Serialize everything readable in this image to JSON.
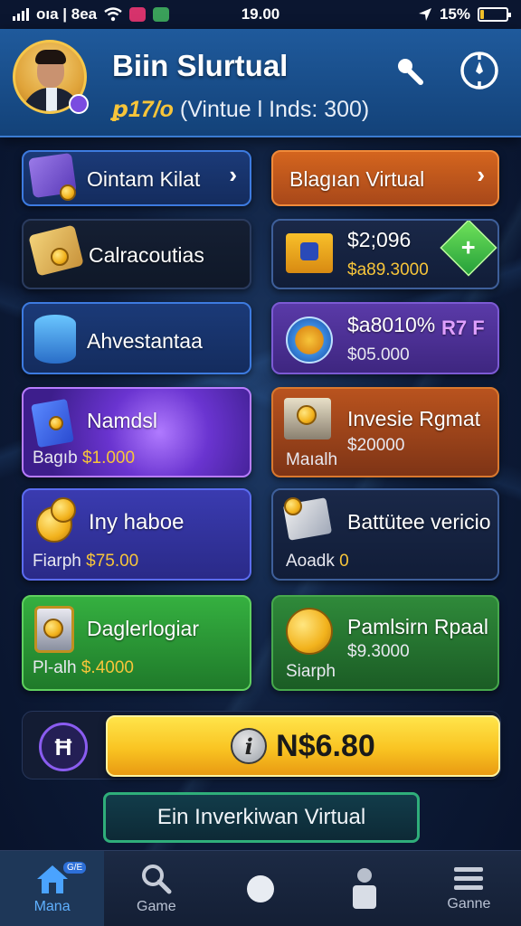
{
  "status_bar": {
    "carrier": "oıa | 8ea",
    "time": "19.00",
    "battery_text": "15%",
    "battery_level": 0.15
  },
  "header": {
    "title": "Biin Slurtual",
    "subtitle_accent": "ꝑ17/o",
    "subtitle_text": "(Vintue l Inds: 300)"
  },
  "tiles": [
    {
      "title": "Ointam Kilat",
      "chevron": "›",
      "color": "#1b3a78"
    },
    {
      "title": "Blagıan Virtual",
      "chevron": "›",
      "color": "#d4651e"
    },
    {
      "title": "Calracoutias"
    },
    {
      "title": "$2;096",
      "value": "$a89.3000",
      "tag": "+"
    },
    {
      "title": "Ahvestantaa"
    },
    {
      "title": "$a8010%",
      "value": "$05.000",
      "tag": "R7 F"
    },
    {
      "title": "Namdsl",
      "label": "Bagıb",
      "value": "$1.000"
    },
    {
      "title": "Invesie Rgmat",
      "value": "$20000",
      "label": "Maıalh"
    },
    {
      "title": "Iny haboe",
      "label": "Fiarph",
      "value": "$75.00"
    },
    {
      "title": "Battütee vericio",
      "label": "Aoadk",
      "value": "0"
    },
    {
      "title": "Daglerlogiar",
      "label": "Pl-alh",
      "value": "$.4000"
    },
    {
      "title": "Pamlsirn Rpaal",
      "value": "$9.3000",
      "label": "Siarph"
    }
  ],
  "action_row": {
    "circle_symbol": "Ħ",
    "balance_label": "N$6.80"
  },
  "cta_button": "Ein Inverkiwan Virtual",
  "bottom_nav": [
    {
      "label": "Mana",
      "icon": "home-icon",
      "badge": "G/E",
      "active": true
    },
    {
      "label": "Game",
      "icon": "search-icon"
    },
    {
      "label": "",
      "icon": "circle-icon"
    },
    {
      "label": "",
      "icon": "person-icon"
    },
    {
      "label": "Ganne",
      "icon": "menu-icon"
    }
  ],
  "colors": {
    "accent_gold": "#f7c53a",
    "header_blue": "#1f5a9c",
    "cta_yellow": "#f9c422"
  }
}
